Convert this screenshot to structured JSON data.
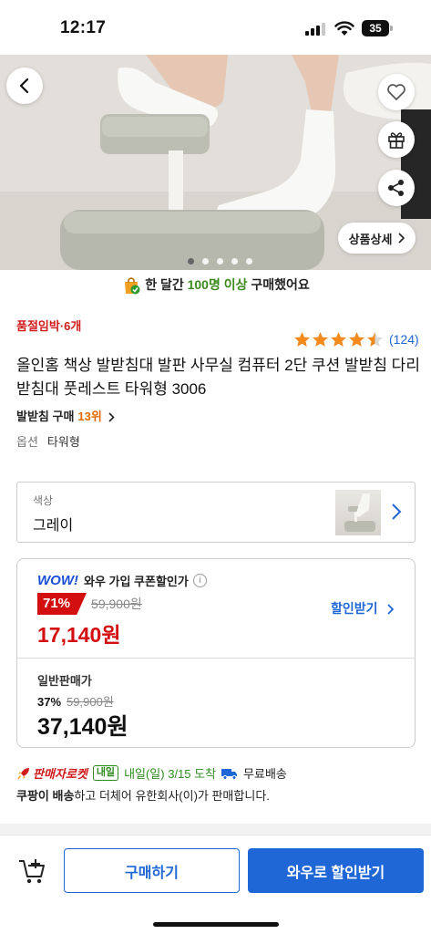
{
  "status_bar": {
    "time": "12:17",
    "battery": "35"
  },
  "hero": {
    "detail_button": "상품상세",
    "image_count": 5,
    "active_index": 0
  },
  "buy_count": {
    "prefix": "한 달간 ",
    "highlight": "100명 이상",
    "suffix": " 구매했어요"
  },
  "product": {
    "stock_alert": "품절임박·6개",
    "rating": 4.5,
    "review_count": "(124)",
    "title": "올인홈 책상 발받침대 발판 사무실 컴퓨터 2단 쿠션 발받침 다리받침대 풋레스트 타워형 3006",
    "rank_category": "발받침 구매",
    "rank_value": "13위",
    "option_key": "옵션",
    "option_value": "타워형"
  },
  "color_select": {
    "label": "색상",
    "value": "그레이"
  },
  "price": {
    "wow_logo": "WOW!",
    "wow_label": "와우 가입 쿠폰할인가",
    "discount_rate": "71%",
    "original_price": "59,900원",
    "wow_price": "17,140원",
    "coupon_link": "할인받기",
    "normal_label": "일반판매가",
    "normal_discount": "37%",
    "normal_original": "59,900원",
    "normal_price": "37,140원"
  },
  "delivery": {
    "rocket": "판매자로켓",
    "tomorrow_badge": "내일",
    "eta": "내일(일) 3/15 도착",
    "free_shipping": "무료배송",
    "seller_name": "쿠팡이 배송",
    "seller_suffix": "하고 더체어 유한회사(이)가 판매합니다."
  },
  "bottom_bar": {
    "buy_button": "구매하기",
    "wow_button": "와우로 할인받기"
  },
  "colors": {
    "accent_blue": "#1f66d6",
    "price_red": "#d30f0f",
    "rocket_red": "#d11a1a",
    "star_orange": "#f28a1e"
  }
}
